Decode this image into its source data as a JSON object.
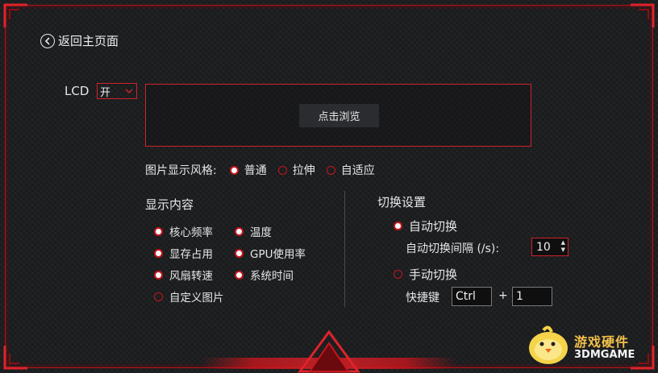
{
  "nav": {
    "back_label": "返回主页面"
  },
  "lcd": {
    "label": "LCD",
    "value": "开"
  },
  "preview": {
    "browse_label": "点击浏览"
  },
  "image_style": {
    "label": "图片显示风格:",
    "options": [
      {
        "label": "普通",
        "selected": true
      },
      {
        "label": "拉伸",
        "selected": false
      },
      {
        "label": "自适应",
        "selected": false
      }
    ]
  },
  "display_content": {
    "title": "显示内容",
    "items": [
      {
        "label": "核心频率",
        "selected": true
      },
      {
        "label": "温度",
        "selected": true
      },
      {
        "label": "显存占用",
        "selected": true
      },
      {
        "label": "GPU使用率",
        "selected": true
      },
      {
        "label": "风扇转速",
        "selected": true
      },
      {
        "label": "系统时间",
        "selected": true
      },
      {
        "label": "自定义图片",
        "selected": false
      }
    ]
  },
  "switch_settings": {
    "title": "切换设置",
    "auto_label": "自动切换",
    "auto_selected": true,
    "interval_label": "自动切换间隔 (/s):",
    "interval_value": "10",
    "manual_label": "手动切换",
    "manual_selected": false,
    "hotkey_label": "快捷键",
    "hotkey_modifier": "Ctrl",
    "hotkey_plus": "+",
    "hotkey_key": "1"
  },
  "watermark": {
    "line1": "游戏硬件",
    "line2": "3DMGAME"
  },
  "colors": {
    "accent": "#c4161d",
    "background": "#1a1b1d"
  }
}
